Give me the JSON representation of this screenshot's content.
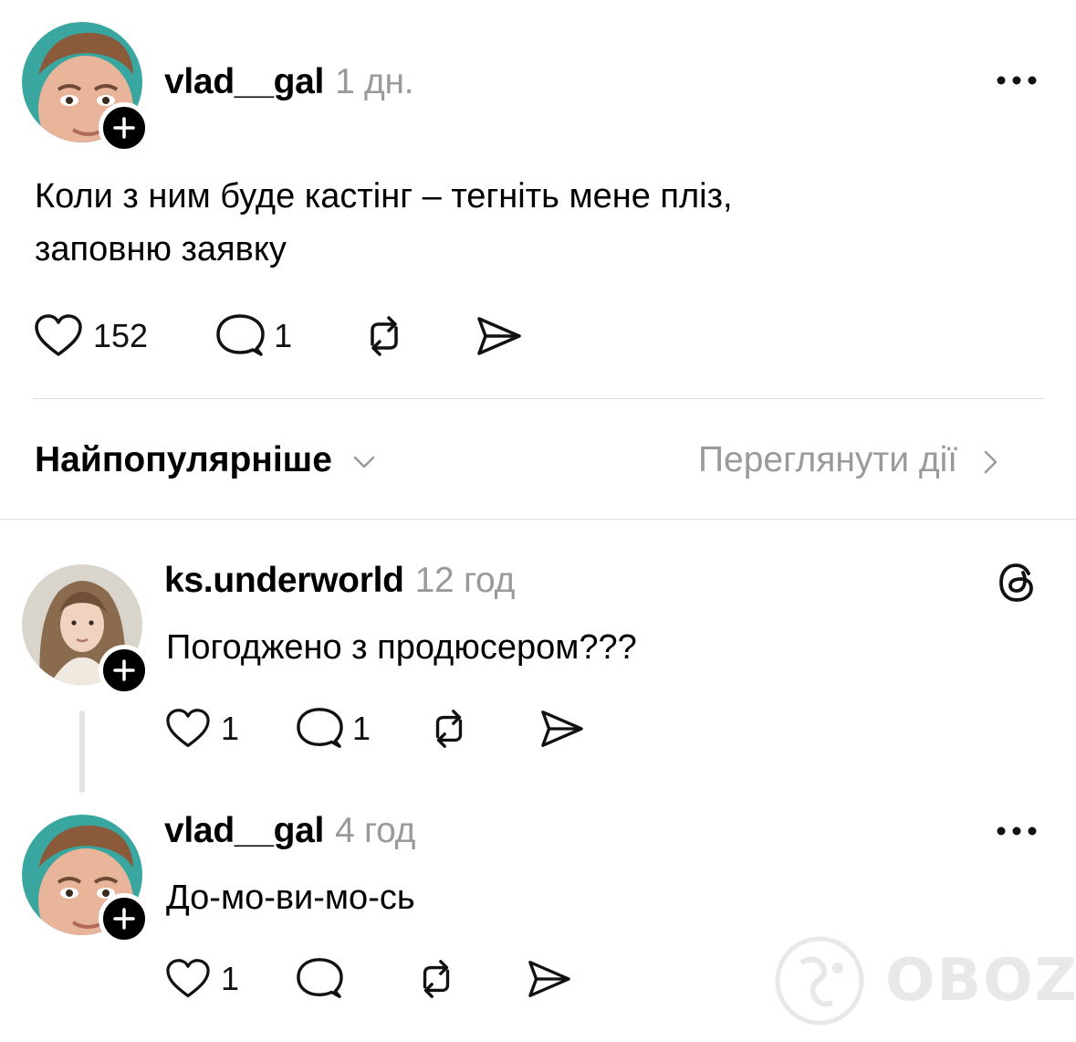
{
  "post": {
    "username": "vlad__gal",
    "time": "1 дн.",
    "text_line1": "Коли з ним буде кастінг – тегніть мене пліз,",
    "text_line2": "заповню заявку",
    "likes": "152",
    "replies": "1"
  },
  "sort": {
    "label": "Найпопулярніше",
    "activity_link": "Переглянути дії"
  },
  "comments": [
    {
      "username": "ks.underworld",
      "time": "12 год",
      "text": "Погоджено з продюсером???",
      "likes": "1",
      "replies": "1"
    },
    {
      "username": "vlad__gal",
      "time": "4 год",
      "text": "До-мо-ви-мо-сь",
      "likes": "1",
      "replies": ""
    }
  ],
  "watermark": "OBOZ.UA",
  "icons": {
    "like": "heart-icon",
    "reply": "comment-bubble-icon",
    "repost": "repost-icon",
    "share": "send-icon",
    "more": "more-dots-icon",
    "threads": "threads-logo-icon",
    "follow": "plus-icon"
  }
}
